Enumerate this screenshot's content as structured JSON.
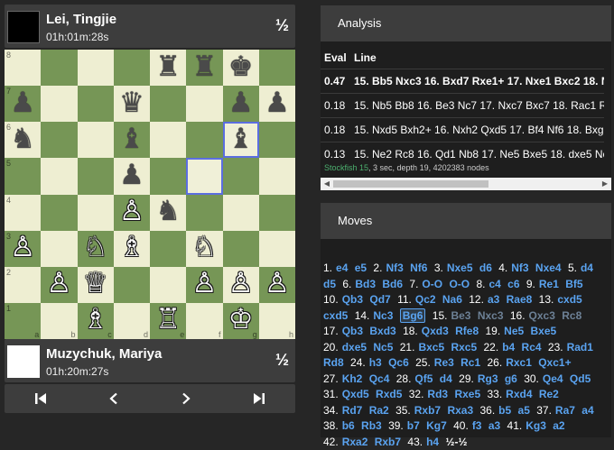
{
  "top_player": {
    "name": "Lei, Tingjie",
    "time": "01h:01m:28s",
    "score": "½",
    "color": "black"
  },
  "bottom_player": {
    "name": "Muzychuk, Mariya",
    "time": "01h:20m:27s",
    "score": "½",
    "color": "white"
  },
  "board": {
    "rank_labels": [
      "8",
      "7",
      "6",
      "5",
      "4",
      "3",
      "2",
      "1"
    ],
    "file_labels": [
      "a",
      "b",
      "c",
      "d",
      "e",
      "f",
      "g",
      "h"
    ],
    "squares": [
      [
        "",
        "",
        "",
        "",
        "bR",
        "bR",
        "bK",
        ""
      ],
      [
        "bP",
        "",
        "",
        "bQ",
        "",
        "",
        "bP",
        "bP"
      ],
      [
        "bN",
        "",
        "",
        "bB",
        "",
        "",
        "bB",
        ""
      ],
      [
        "",
        "",
        "",
        "bP",
        "",
        "",
        "",
        ""
      ],
      [
        "",
        "",
        "",
        "wP",
        "bN",
        "",
        "",
        ""
      ],
      [
        "wP",
        "",
        "wN",
        "wB",
        "",
        "wN",
        "",
        ""
      ],
      [
        "",
        "wP",
        "wQ",
        "",
        "",
        "wP",
        "wP",
        "wP"
      ],
      [
        "",
        "",
        "wB",
        "",
        "wR",
        "",
        "wK",
        ""
      ]
    ],
    "highlight_squares": [
      "g6",
      "f5"
    ]
  },
  "nav_icons": [
    "first-move-icon",
    "previous-move-icon",
    "next-move-icon",
    "last-move-icon"
  ],
  "analysis": {
    "title": "Analysis",
    "col_eval": "Eval",
    "col_line": "Line",
    "rows": [
      {
        "eval": "0.47",
        "line": "15. Bb5 Nxc3 16. Bxd7 Rxe1+ 17. Nxe1 Bxc2 18. Nxc2"
      },
      {
        "eval": "0.18",
        "line": "15. Nb5 Bb8 16. Be3 Nc7 17. Nxc7 Bxc7 18. Rac1 Rc8 19."
      },
      {
        "eval": "0.18",
        "line": "15. Nxd5 Bxh2+ 16. Nxh2 Qxd5 17. Bf4 Nf6 18. Bxg6 hxg6"
      },
      {
        "eval": "0.13",
        "line": "15. Ne2 Rc8 16. Qd1 Nb8 17. Ne5 Bxe5 18. dxe5 Nc6 19."
      }
    ],
    "engine_name": "Stockfish 15",
    "engine_info": ", 3 sec, depth 19, 4202383 nodes"
  },
  "moves": {
    "title": "Moves",
    "list": [
      [
        "1.",
        "e4",
        "e5"
      ],
      [
        "2.",
        "Nf3",
        "Nf6"
      ],
      [
        "3.",
        "Nxe5",
        "d6"
      ],
      [
        "4.",
        "Nf3",
        "Nxe4"
      ],
      [
        "5.",
        "d4",
        "d5"
      ],
      [
        "6.",
        "Bd3",
        "Bd6"
      ],
      [
        "7.",
        "O-O",
        "O-O"
      ],
      [
        "8.",
        "c4",
        "c6"
      ],
      [
        "9.",
        "Re1",
        "Bf5"
      ],
      [
        "10.",
        "Qb3",
        "Qd7"
      ],
      [
        "11.",
        "Qc2",
        "Na6"
      ],
      [
        "12.",
        "a3",
        "Rae8"
      ],
      [
        "13.",
        "cxd5",
        "cxd5"
      ],
      [
        "14.",
        "Nc3",
        "Bg6"
      ],
      [
        "15.",
        "Be3",
        "Nxc3"
      ],
      [
        "16.",
        "Qxc3",
        "Rc8"
      ],
      [
        "17.",
        "Qb3",
        "Bxd3"
      ],
      [
        "18.",
        "Qxd3",
        "Rfe8"
      ],
      [
        "19.",
        "Ne5",
        "Bxe5"
      ],
      [
        "20.",
        "dxe5",
        "Nc5"
      ],
      [
        "21.",
        "Bxc5",
        "Rxc5"
      ],
      [
        "22.",
        "b4",
        "Rc4"
      ],
      [
        "23.",
        "Rad1",
        "Rd8"
      ],
      [
        "24.",
        "h3",
        "Qc6"
      ],
      [
        "25.",
        "Re3",
        "Rc1"
      ],
      [
        "26.",
        "Rxc1",
        "Qxc1+"
      ],
      [
        "27.",
        "Kh2",
        "Qc4"
      ],
      [
        "28.",
        "Qf5",
        "d4"
      ],
      [
        "29.",
        "Rg3",
        "g6"
      ],
      [
        "30.",
        "Qe4",
        "Qd5"
      ],
      [
        "31.",
        "Qxd5",
        "Rxd5"
      ],
      [
        "32.",
        "Rd3",
        "Rxe5"
      ],
      [
        "33.",
        "Rxd4",
        "Re2"
      ],
      [
        "34.",
        "Rd7",
        "Ra2"
      ],
      [
        "35.",
        "Rxb7",
        "Rxa3"
      ],
      [
        "36.",
        "b5",
        "a5"
      ],
      [
        "37.",
        "Ra7",
        "a4"
      ],
      [
        "38.",
        "b6",
        "Rb3"
      ],
      [
        "39.",
        "b7",
        "Kg7"
      ],
      [
        "40.",
        "f3",
        "a3"
      ],
      [
        "41.",
        "Kg3",
        "a2"
      ],
      [
        "42.",
        "Rxa2",
        "Rxb7"
      ],
      [
        "43.",
        "h4",
        ""
      ]
    ],
    "current_move": "Bg6",
    "result": "½-½"
  }
}
